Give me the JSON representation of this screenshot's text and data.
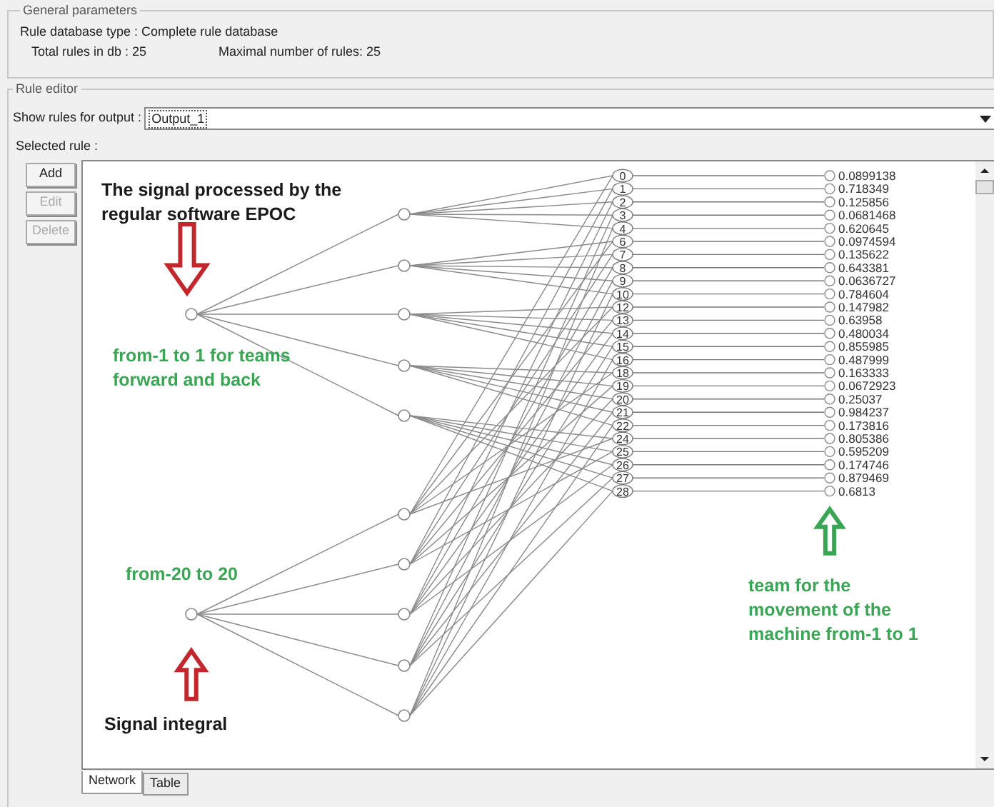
{
  "general_parameters": {
    "title": "General parameters",
    "database_type": "Rule database type : Complete rule database",
    "total_rules": "Total rules in db : 25",
    "max_rules": "Maximal number of rules: 25"
  },
  "rule_editor": {
    "title": "Rule editor",
    "output_label": "Show rules for output :",
    "output_value": "Output_1",
    "selected_rule_label": "Selected rule :",
    "buttons": [
      {
        "label": "Add",
        "disabled": false
      },
      {
        "label": "Edit",
        "disabled": true
      },
      {
        "label": "Delete",
        "disabled": true
      }
    ]
  },
  "network": {
    "rules": [
      {
        "number": "0",
        "value": "0.0899138"
      },
      {
        "number": "1",
        "value": "0.718349"
      },
      {
        "number": "2",
        "value": "0.125856"
      },
      {
        "number": "3",
        "value": "0.0681468"
      },
      {
        "number": "4",
        "value": "0.620645"
      },
      {
        "number": "6",
        "value": "0.0974594"
      },
      {
        "number": "7",
        "value": "0.135622"
      },
      {
        "number": "8",
        "value": "0.643381"
      },
      {
        "number": "9",
        "value": "0.0636727"
      },
      {
        "number": "10",
        "value": "0.784604"
      },
      {
        "number": "12",
        "value": "0.147982"
      },
      {
        "number": "13",
        "value": "0.63958"
      },
      {
        "number": "14",
        "value": "0.480034"
      },
      {
        "number": "15",
        "value": "0.855985"
      },
      {
        "number": "16",
        "value": "0.487999"
      },
      {
        "number": "18",
        "value": "0.163333"
      },
      {
        "number": "19",
        "value": "0.0672923"
      },
      {
        "number": "20",
        "value": "0.25037"
      },
      {
        "number": "21",
        "value": "0.984237"
      },
      {
        "number": "22",
        "value": "0.173816"
      },
      {
        "number": "24",
        "value": "0.805386"
      },
      {
        "number": "25",
        "value": "0.595209"
      },
      {
        "number": "26",
        "value": "0.174746"
      },
      {
        "number": "27",
        "value": "0.879469"
      },
      {
        "number": "28",
        "value": "0.6813"
      }
    ],
    "annotations": [
      {
        "kind": "text",
        "text": "The signal processed by the regular software EPOC",
        "color": "#1a1a1a"
      },
      {
        "kind": "down_arrow",
        "color": "#c1272d"
      },
      {
        "kind": "text",
        "text": "from-1 to 1 for teams forward and back",
        "color": "#3aa655"
      },
      {
        "kind": "text",
        "text": "from-20 to 20",
        "color": "#3aa655"
      },
      {
        "kind": "up_arrow",
        "color": "#c1272d"
      },
      {
        "kind": "text",
        "text": "Signal integral",
        "color": "#1a1a1a"
      },
      {
        "kind": "up_arrow",
        "color": "#3aa655"
      },
      {
        "kind": "text",
        "text": "team for the movement of the machine from-1 to 1",
        "color": "#3aa655"
      }
    ]
  },
  "tabs": [
    {
      "label": "Network",
      "selected": true
    },
    {
      "label": "Table",
      "selected": false
    }
  ]
}
